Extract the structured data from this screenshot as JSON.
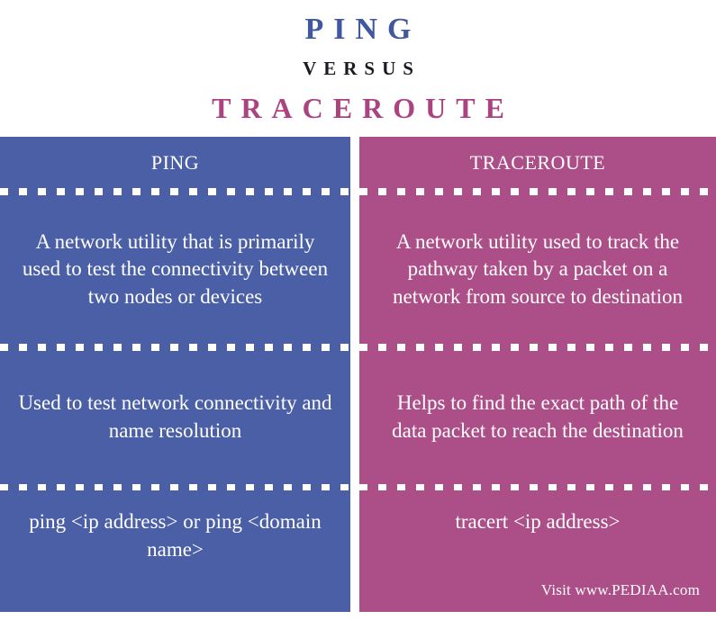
{
  "header": {
    "title_primary": "PING",
    "title_connector": "VERSUS",
    "title_secondary": "TRACEROUTE",
    "color_primary": "#41589f",
    "color_connector": "#1b1b24",
    "color_secondary": "#ab4381"
  },
  "table": {
    "columns": [
      {
        "id": "ping",
        "header": "PING",
        "background": "#4a5fa5",
        "rows": [
          "A network utility that is primarily used to test the connectivity between two nodes or devices",
          "Used to test network connectivity and name resolution",
          "ping <ip address> or ping <domain name>"
        ]
      },
      {
        "id": "traceroute",
        "header": "TRACEROUTE",
        "background": "#ac4f89",
        "rows": [
          "A network utility used to track the pathway taken by a packet on a network from source to destination",
          "Helps to find the exact path of the data packet to reach the destination",
          "tracert <ip address>"
        ]
      }
    ]
  },
  "credit": {
    "text": "Visit www.PEDIAA.com"
  }
}
